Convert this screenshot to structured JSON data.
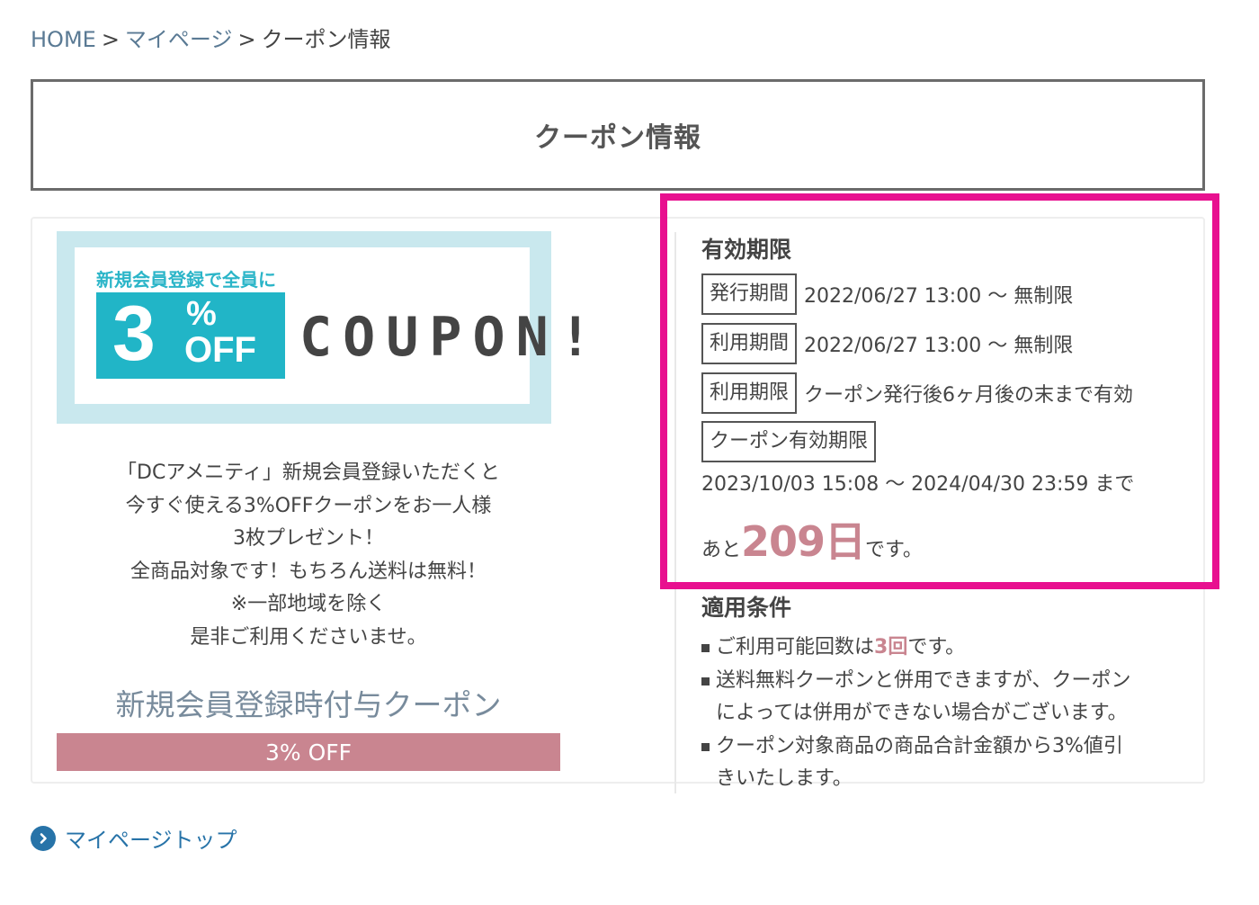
{
  "breadcrumb": {
    "home": "HOME",
    "separator": ">",
    "mypage": "マイページ",
    "current": "クーポン情報"
  },
  "page_title": "クーポン情報",
  "banner": {
    "tagline": "新規会員登録で全員に",
    "number": "3",
    "percent": "%",
    "off": "OFF",
    "coupon_text": "COUPON!"
  },
  "description": [
    "「DCアメニティ」新規会員登録いただくと",
    "今すぐ使える3%OFFクーポンをお一人様",
    "3枚プレゼント！",
    "全商品対象です！もちろん送料は無料！",
    "※一部地域を除く",
    "是非ご利用くださいませ。"
  ],
  "coupon_name": "新規会員登録時付与クーポン",
  "discount_label": "3% OFF",
  "validity": {
    "heading": "有効期限",
    "rows": [
      {
        "tag": "発行期間",
        "value": "2022/06/27 13:00 〜 無制限"
      },
      {
        "tag": "利用期間",
        "value": "2022/06/27 13:00 〜 無制限"
      },
      {
        "tag": "利用期限",
        "value": "クーポン発行後6ヶ月後の末まで有効"
      }
    ],
    "coupon_validity_tag": "クーポン有効期限",
    "coupon_validity_range": "2023/10/03 15:08 〜 2024/04/30 23:59 まで",
    "remaining_prefix": "あと",
    "remaining_days": "209日",
    "remaining_suffix": "です。"
  },
  "conditions": {
    "heading": "適用条件",
    "item1_prefix": "ご利用可能回数は",
    "item1_count": "3回",
    "item1_suffix": "です。",
    "item2_line1": "送料無料クーポンと併用できますが、クーポン",
    "item2_line2": "によっては併用ができない場合がございます。",
    "item3_line1": "クーポン対象商品の商品合計金額から3%値引",
    "item3_line2": "きいたします。"
  },
  "bottom_link": {
    "label": "マイページトップ",
    "icon": "chevron-right-circle-icon"
  },
  "colors": {
    "accent_pink": "#c98590",
    "highlight_magenta": "#e8108f",
    "banner_teal": "#21b5c7",
    "link_blue": "#2773a8"
  }
}
